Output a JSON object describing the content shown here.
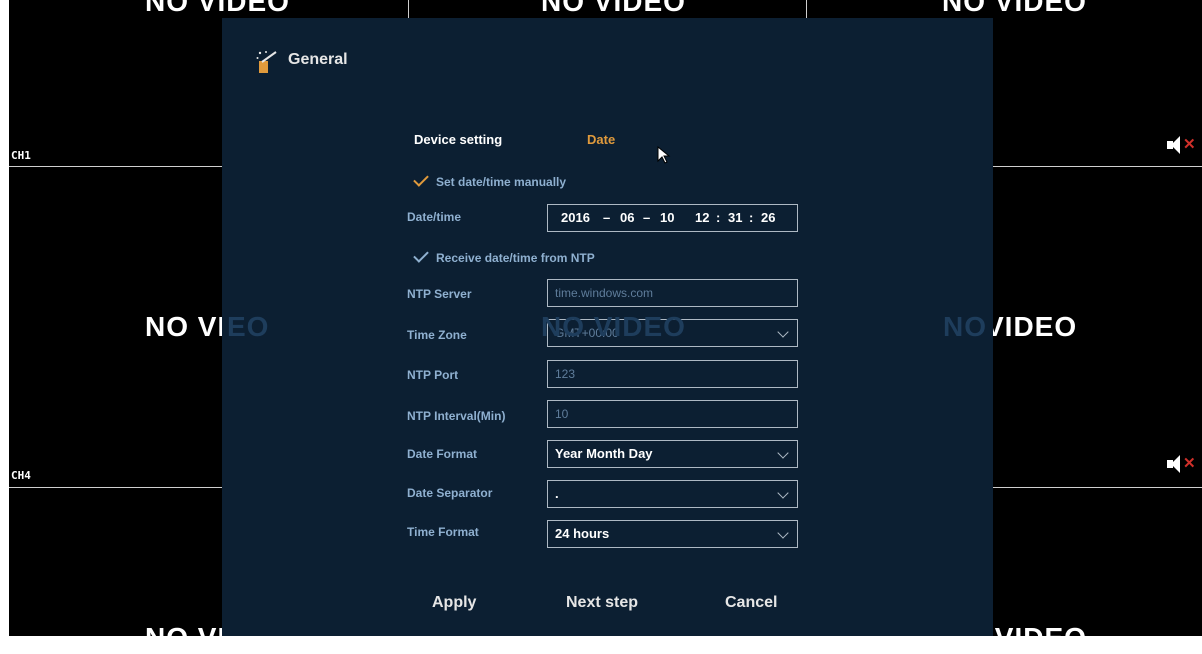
{
  "background": {
    "no_video_label": "NO VIDEO",
    "no_video_partial_left": "NO VID",
    "no_video_partial_left_rest": "EO",
    "no_video_partial_mid": "NO VIDEO",
    "no_video_partial_right_prefix": "NO",
    "no_video_partial_right": "VIDEO",
    "channels": [
      "CH1",
      "CH4"
    ]
  },
  "header": {
    "title": "General",
    "icon": "wand-icon"
  },
  "tabs": [
    {
      "label": "Device setting",
      "active": false
    },
    {
      "label": "Date",
      "active": true
    }
  ],
  "manual": {
    "checkbox_label": "Set date/time manually",
    "datetime_label": "Date/time",
    "date": {
      "year": "2016",
      "month": "06",
      "day": "10"
    },
    "time": {
      "hour": "12",
      "minute": "31",
      "second": "26"
    },
    "sep_date": "–",
    "sep_time": ":"
  },
  "ntp": {
    "checkbox_label": "Receive date/time from NTP",
    "server_label": "NTP Server",
    "server_value": "time.windows.com",
    "zone_label": "Time Zone",
    "zone_value": "GMT+00:00",
    "port_label": "NTP Port",
    "port_value": "123",
    "interval_label": "NTP Interval(Min)",
    "interval_value": "10"
  },
  "format": {
    "date_format_label": "Date Format",
    "date_format_value": "Year Month Day",
    "date_separator_label": "Date Separator",
    "date_separator_value": ".",
    "time_format_label": "Time Format",
    "time_format_value": "24 hours"
  },
  "buttons": {
    "apply": "Apply",
    "next": "Next step",
    "cancel": "Cancel"
  },
  "colors": {
    "panel": "#0c1f32",
    "accent": "#e09a3c",
    "label": "#8fb0d0",
    "mute_x": "#d0302a"
  }
}
